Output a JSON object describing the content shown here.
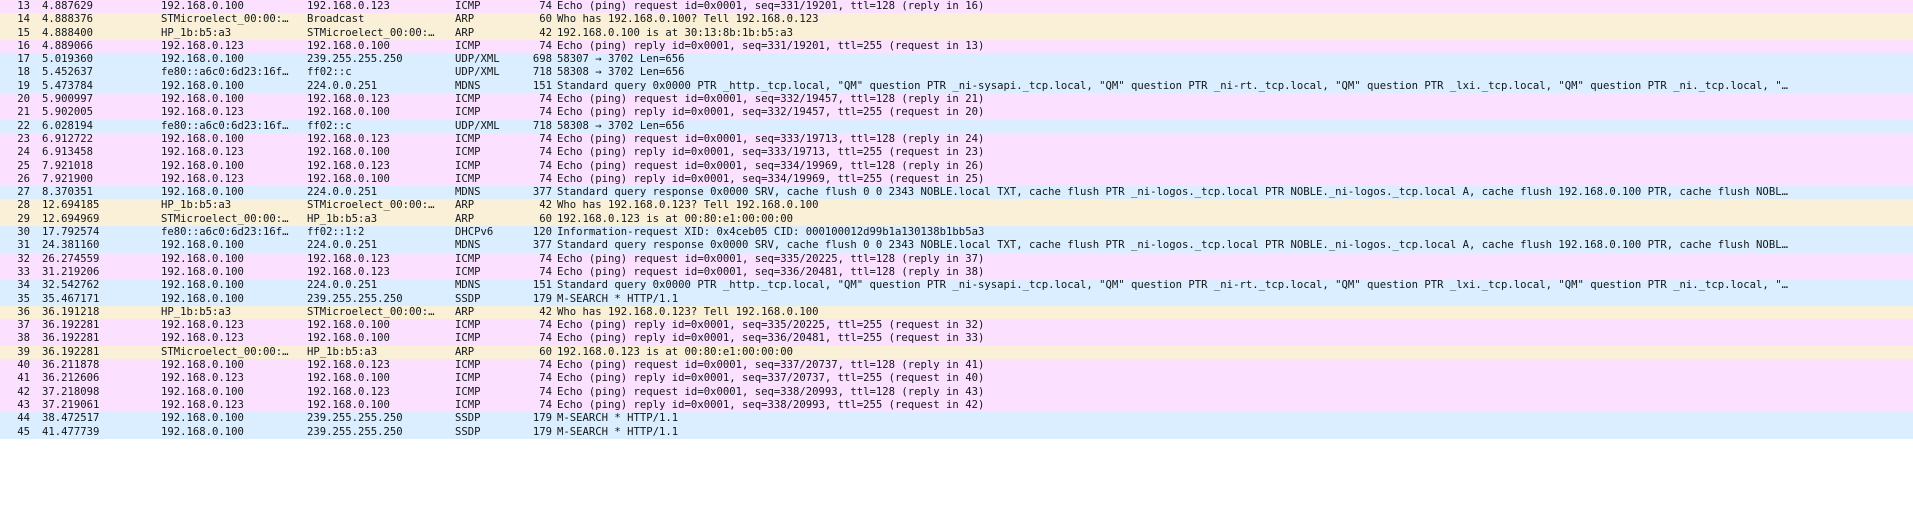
{
  "colors": {
    "ICMP": "#fce0ff",
    "ARP": "#faf0d7",
    "UDP": "#daeeff",
    "MDNS": "#daeeff",
    "SSDP": "#daeeff",
    "DHCPv6": "#daeeff"
  },
  "rows": [
    {
      "no": "13",
      "time": "4.887629",
      "src": "192.168.0.100",
      "dst": "192.168.0.123",
      "proto": "ICMP",
      "len": "74",
      "info": "Echo (ping) request  id=0x0001, seq=331/19201, ttl=128 (reply in 16)",
      "color": "ICMP"
    },
    {
      "no": "14",
      "time": "4.888376",
      "src": "STMicroelect_00:00:…",
      "dst": "Broadcast",
      "proto": "ARP",
      "len": "60",
      "info": "Who has 192.168.0.100? Tell 192.168.0.123",
      "color": "ARP"
    },
    {
      "no": "15",
      "time": "4.888400",
      "src": "HP_1b:b5:a3",
      "dst": "STMicroelect_00:00:…",
      "proto": "ARP",
      "len": "42",
      "info": "192.168.0.100 is at 30:13:8b:1b:b5:a3",
      "color": "ARP"
    },
    {
      "no": "16",
      "time": "4.889066",
      "src": "192.168.0.123",
      "dst": "192.168.0.100",
      "proto": "ICMP",
      "len": "74",
      "info": "Echo (ping) reply    id=0x0001, seq=331/19201, ttl=255 (request in 13)",
      "color": "ICMP"
    },
    {
      "no": "17",
      "time": "5.019360",
      "src": "192.168.0.100",
      "dst": "239.255.255.250",
      "proto": "UDP/XML",
      "len": "698",
      "info": "58307 → 3702 Len=656",
      "color": "UDP"
    },
    {
      "no": "18",
      "time": "5.452637",
      "src": "fe80::a6c0:6d23:16f…",
      "dst": "ff02::c",
      "proto": "UDP/XML",
      "len": "718",
      "info": "58308 → 3702 Len=656",
      "color": "UDP"
    },
    {
      "no": "19",
      "time": "5.473784",
      "src": "192.168.0.100",
      "dst": "224.0.0.251",
      "proto": "MDNS",
      "len": "151",
      "info": "Standard query 0x0000 PTR _http._tcp.local, \"QM\" question PTR _ni-sysapi._tcp.local, \"QM\" question PTR _ni-rt._tcp.local, \"QM\" question PTR _lxi._tcp.local, \"QM\" question PTR _ni._tcp.local, \"…",
      "color": "MDNS"
    },
    {
      "no": "20",
      "time": "5.900997",
      "src": "192.168.0.100",
      "dst": "192.168.0.123",
      "proto": "ICMP",
      "len": "74",
      "info": "Echo (ping) request  id=0x0001, seq=332/19457, ttl=128 (reply in 21)",
      "color": "ICMP"
    },
    {
      "no": "21",
      "time": "5.902005",
      "src": "192.168.0.123",
      "dst": "192.168.0.100",
      "proto": "ICMP",
      "len": "74",
      "info": "Echo (ping) reply    id=0x0001, seq=332/19457, ttl=255 (request in 20)",
      "color": "ICMP"
    },
    {
      "no": "22",
      "time": "6.028194",
      "src": "fe80::a6c0:6d23:16f…",
      "dst": "ff02::c",
      "proto": "UDP/XML",
      "len": "718",
      "info": "58308 → 3702 Len=656",
      "color": "UDP"
    },
    {
      "no": "23",
      "time": "6.912722",
      "src": "192.168.0.100",
      "dst": "192.168.0.123",
      "proto": "ICMP",
      "len": "74",
      "info": "Echo (ping) request  id=0x0001, seq=333/19713, ttl=128 (reply in 24)",
      "color": "ICMP"
    },
    {
      "no": "24",
      "time": "6.913458",
      "src": "192.168.0.123",
      "dst": "192.168.0.100",
      "proto": "ICMP",
      "len": "74",
      "info": "Echo (ping) reply    id=0x0001, seq=333/19713, ttl=255 (request in 23)",
      "color": "ICMP"
    },
    {
      "no": "25",
      "time": "7.921018",
      "src": "192.168.0.100",
      "dst": "192.168.0.123",
      "proto": "ICMP",
      "len": "74",
      "info": "Echo (ping) request  id=0x0001, seq=334/19969, ttl=128 (reply in 26)",
      "color": "ICMP"
    },
    {
      "no": "26",
      "time": "7.921900",
      "src": "192.168.0.123",
      "dst": "192.168.0.100",
      "proto": "ICMP",
      "len": "74",
      "info": "Echo (ping) reply    id=0x0001, seq=334/19969, ttl=255 (request in 25)",
      "color": "ICMP"
    },
    {
      "no": "27",
      "time": "8.370351",
      "src": "192.168.0.100",
      "dst": "224.0.0.251",
      "proto": "MDNS",
      "len": "377",
      "info": "Standard query response 0x0000 SRV, cache flush 0 0 2343 NOBLE.local TXT, cache flush PTR _ni-logos._tcp.local PTR NOBLE._ni-logos._tcp.local A, cache flush 192.168.0.100 PTR, cache flush NOBL…",
      "color": "MDNS"
    },
    {
      "no": "28",
      "time": "12.694185",
      "src": "HP_1b:b5:a3",
      "dst": "STMicroelect_00:00:…",
      "proto": "ARP",
      "len": "42",
      "info": "Who has 192.168.0.123? Tell 192.168.0.100",
      "color": "ARP"
    },
    {
      "no": "29",
      "time": "12.694969",
      "src": "STMicroelect_00:00:…",
      "dst": "HP_1b:b5:a3",
      "proto": "ARP",
      "len": "60",
      "info": "192.168.0.123 is at 00:80:e1:00:00:00",
      "color": "ARP"
    },
    {
      "no": "30",
      "time": "17.792574",
      "src": "fe80::a6c0:6d23:16f…",
      "dst": "ff02::1:2",
      "proto": "DHCPv6",
      "len": "120",
      "info": "Information-request XID: 0x4ceb05 CID: 000100012d99b1a130138b1bb5a3",
      "color": "DHCPv6"
    },
    {
      "no": "31",
      "time": "24.381160",
      "src": "192.168.0.100",
      "dst": "224.0.0.251",
      "proto": "MDNS",
      "len": "377",
      "info": "Standard query response 0x0000 SRV, cache flush 0 0 2343 NOBLE.local TXT, cache flush PTR _ni-logos._tcp.local PTR NOBLE._ni-logos._tcp.local A, cache flush 192.168.0.100 PTR, cache flush NOBL…",
      "color": "MDNS"
    },
    {
      "no": "32",
      "time": "26.274559",
      "src": "192.168.0.100",
      "dst": "192.168.0.123",
      "proto": "ICMP",
      "len": "74",
      "info": "Echo (ping) request  id=0x0001, seq=335/20225, ttl=128 (reply in 37)",
      "color": "ICMP"
    },
    {
      "no": "33",
      "time": "31.219206",
      "src": "192.168.0.100",
      "dst": "192.168.0.123",
      "proto": "ICMP",
      "len": "74",
      "info": "Echo (ping) request  id=0x0001, seq=336/20481, ttl=128 (reply in 38)",
      "color": "ICMP"
    },
    {
      "no": "34",
      "time": "32.542762",
      "src": "192.168.0.100",
      "dst": "224.0.0.251",
      "proto": "MDNS",
      "len": "151",
      "info": "Standard query 0x0000 PTR _http._tcp.local, \"QM\" question PTR _ni-sysapi._tcp.local, \"QM\" question PTR _ni-rt._tcp.local, \"QM\" question PTR _lxi._tcp.local, \"QM\" question PTR _ni._tcp.local, \"…",
      "color": "MDNS"
    },
    {
      "no": "35",
      "time": "35.467171",
      "src": "192.168.0.100",
      "dst": "239.255.255.250",
      "proto": "SSDP",
      "len": "179",
      "info": "M-SEARCH * HTTP/1.1",
      "color": "SSDP"
    },
    {
      "no": "36",
      "time": "36.191218",
      "src": "HP_1b:b5:a3",
      "dst": "STMicroelect_00:00:…",
      "proto": "ARP",
      "len": "42",
      "info": "Who has 192.168.0.123? Tell 192.168.0.100",
      "color": "ARP"
    },
    {
      "no": "37",
      "time": "36.192281",
      "src": "192.168.0.123",
      "dst": "192.168.0.100",
      "proto": "ICMP",
      "len": "74",
      "info": "Echo (ping) reply    id=0x0001, seq=335/20225, ttl=255 (request in 32)",
      "color": "ICMP"
    },
    {
      "no": "38",
      "time": "36.192281",
      "src": "192.168.0.123",
      "dst": "192.168.0.100",
      "proto": "ICMP",
      "len": "74",
      "info": "Echo (ping) reply    id=0x0001, seq=336/20481, ttl=255 (request in 33)",
      "color": "ICMP"
    },
    {
      "no": "39",
      "time": "36.192281",
      "src": "STMicroelect_00:00:…",
      "dst": "HP_1b:b5:a3",
      "proto": "ARP",
      "len": "60",
      "info": "192.168.0.123 is at 00:80:e1:00:00:00",
      "color": "ARP"
    },
    {
      "no": "40",
      "time": "36.211878",
      "src": "192.168.0.100",
      "dst": "192.168.0.123",
      "proto": "ICMP",
      "len": "74",
      "info": "Echo (ping) request  id=0x0001, seq=337/20737, ttl=128 (reply in 41)",
      "color": "ICMP"
    },
    {
      "no": "41",
      "time": "36.212606",
      "src": "192.168.0.123",
      "dst": "192.168.0.100",
      "proto": "ICMP",
      "len": "74",
      "info": "Echo (ping) reply    id=0x0001, seq=337/20737, ttl=255 (request in 40)",
      "color": "ICMP"
    },
    {
      "no": "42",
      "time": "37.218098",
      "src": "192.168.0.100",
      "dst": "192.168.0.123",
      "proto": "ICMP",
      "len": "74",
      "info": "Echo (ping) request  id=0x0001, seq=338/20993, ttl=128 (reply in 43)",
      "color": "ICMP"
    },
    {
      "no": "43",
      "time": "37.219061",
      "src": "192.168.0.123",
      "dst": "192.168.0.100",
      "proto": "ICMP",
      "len": "74",
      "info": "Echo (ping) reply    id=0x0001, seq=338/20993, ttl=255 (request in 42)",
      "color": "ICMP"
    },
    {
      "no": "44",
      "time": "38.472517",
      "src": "192.168.0.100",
      "dst": "239.255.255.250",
      "proto": "SSDP",
      "len": "179",
      "info": "M-SEARCH * HTTP/1.1",
      "color": "SSDP"
    },
    {
      "no": "45",
      "time": "41.477739",
      "src": "192.168.0.100",
      "dst": "239.255.255.250",
      "proto": "SSDP",
      "len": "179",
      "info": "M-SEARCH * HTTP/1.1",
      "color": "SSDP"
    }
  ]
}
